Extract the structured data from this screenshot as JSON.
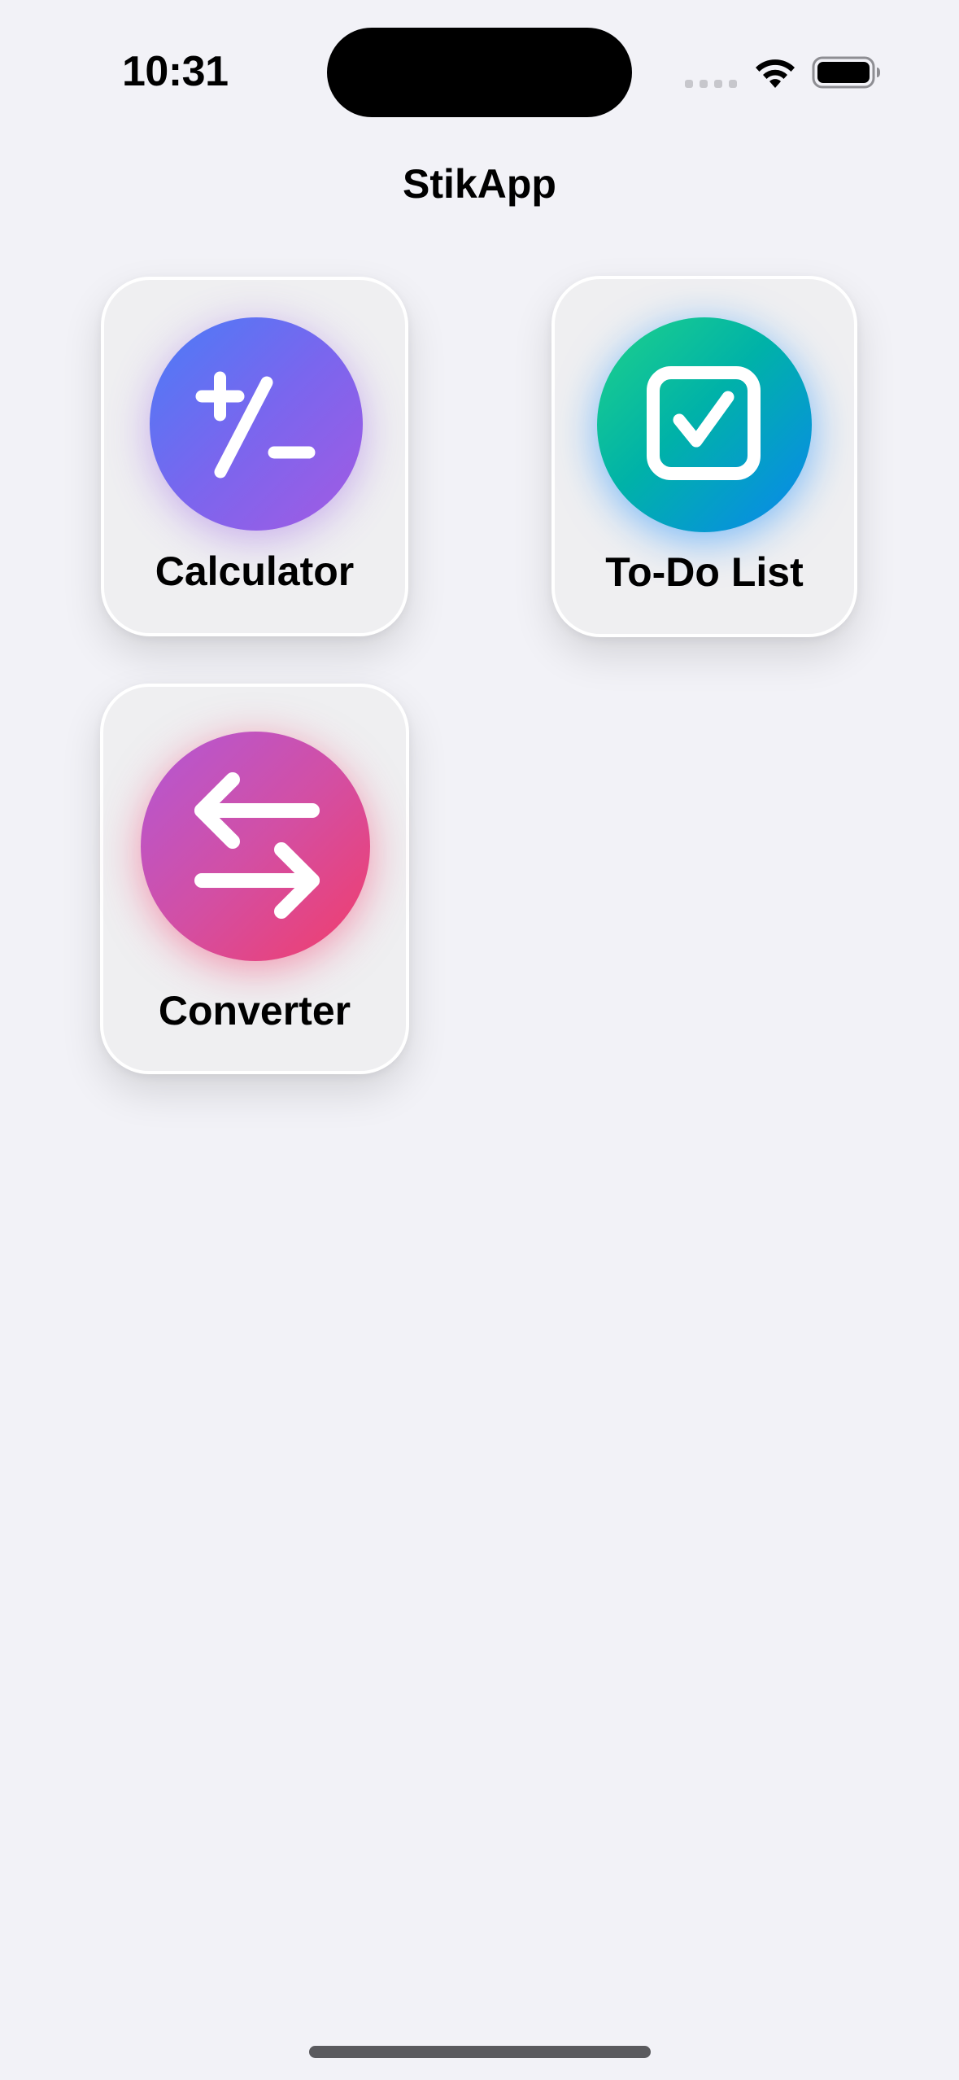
{
  "status_bar": {
    "time": "10:31",
    "icons": [
      "signal-icon",
      "wifi-icon",
      "battery-icon"
    ]
  },
  "header": {
    "title": "StikApp"
  },
  "apps": [
    {
      "label": "Calculator",
      "icon": "plus-minus-icon",
      "gradient": [
        "#4a7cf7",
        "#a45ae2"
      ]
    },
    {
      "label": "To-Do List",
      "icon": "checkbox-icon",
      "gradient": [
        "#1fd28a",
        "#0a86f0"
      ]
    },
    {
      "label": "Converter",
      "icon": "arrows-exchange-icon",
      "gradient": [
        "#b258d6",
        "#f23d6a"
      ]
    }
  ],
  "colors": {
    "background": "#f2f2f7",
    "tile": "#efeff1"
  }
}
